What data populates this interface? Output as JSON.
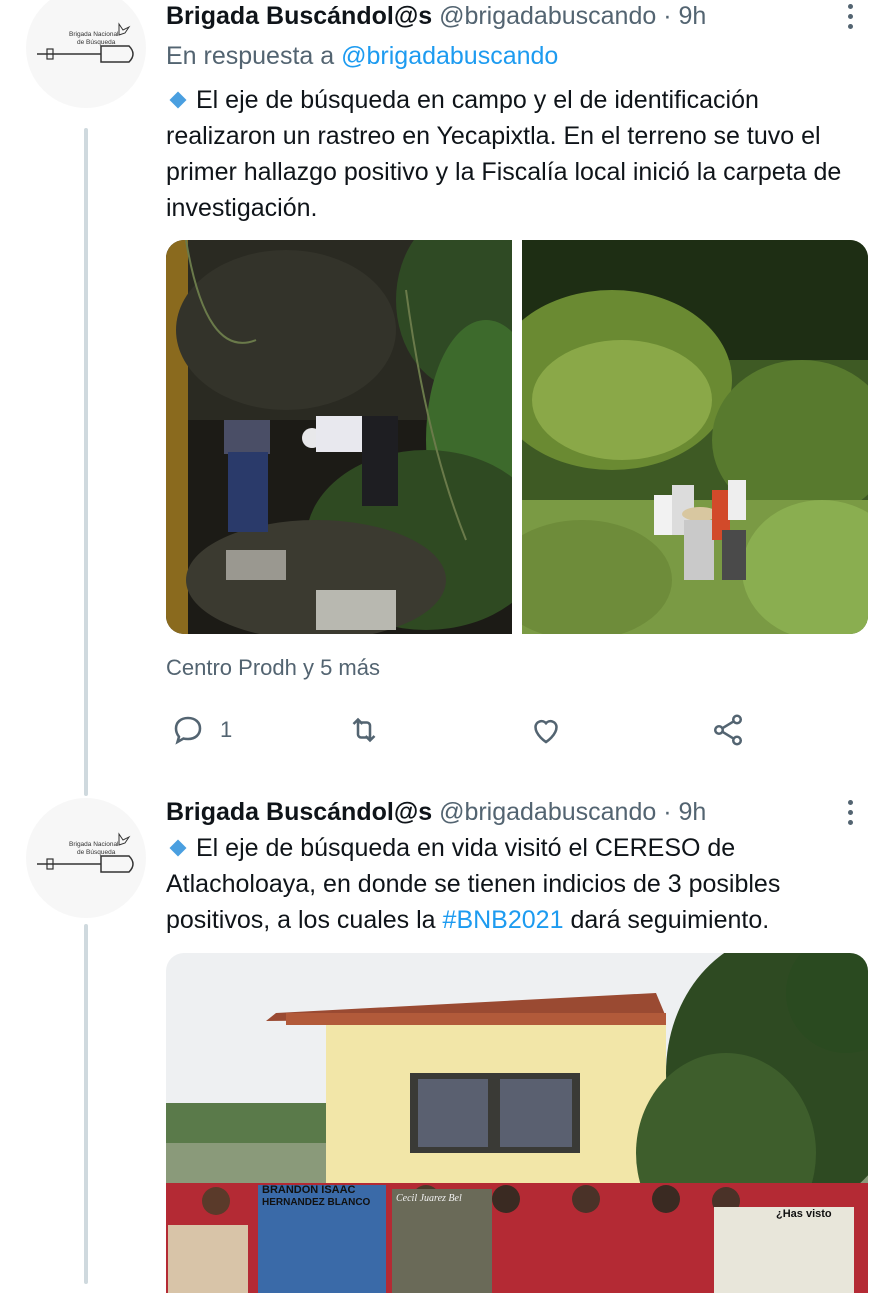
{
  "tweets": [
    {
      "avatar_text": [
        "Brigada Nacional",
        "de Búsqueda"
      ],
      "name": "Brigada Buscándol@s",
      "handle": "@brigadabuscando",
      "time": "· 9h",
      "reply_prefix": "En respuesta a",
      "reply_handle": "@brigadabuscando",
      "text": "El eje de búsqueda en campo y el de identificación realizaron un rastreo en Yecapixtla. En el terreno se tuvo el primer hallazgo positivo y la Fiscalía local inició la carpeta de investigación.",
      "social_context": "Centro Prodh y 5 más",
      "reply_count": "1",
      "icons": [
        "reply-icon",
        "retweet-icon",
        "like-icon",
        "share-icon"
      ]
    },
    {
      "avatar_text": [
        "Brigada Nacional",
        "de Búsqueda"
      ],
      "name": "Brigada Buscándol@s",
      "handle": "@brigadabuscando",
      "time": "· 9h",
      "text_before": "El eje de búsqueda en vida visitó el CERESO de Atlacholoaya, en donde se tienen indicios de 3 posibles positivos, a los cuales la",
      "hashtag": "#BNB2021",
      "text_after": "dará seguimiento.",
      "banner_1": "BRANDON ISAAC",
      "banner_2": "HERNANDEZ BLANCO",
      "banner_3": "Cecil Juarez Bel",
      "banner_4": "¿Has visto"
    }
  ],
  "colors": {
    "link": "#1d9bf0",
    "muted": "#536471",
    "text": "#0f1419",
    "thread": "#cfd9de",
    "bullet": "#4a9fe0"
  }
}
